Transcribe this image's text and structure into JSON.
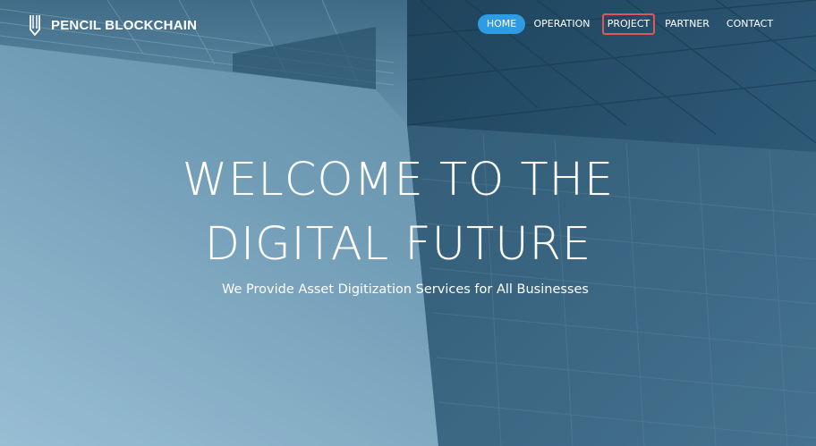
{
  "brand": {
    "name": "PENCIL BLOCKCHAIN",
    "logo_icon": "pencil-icon"
  },
  "nav": {
    "items": [
      {
        "label": "HOME",
        "state": "active"
      },
      {
        "label": "OPERATION"
      },
      {
        "label": "PROJECT",
        "state": "highlighted"
      },
      {
        "label": "PARTNER"
      },
      {
        "label": "CONTACT"
      }
    ]
  },
  "hero": {
    "headline_line1": "WELCOME TO THE",
    "headline_line2": "DIGITAL FUTURE",
    "subtitle": "We Provide Asset Digitization Services for All Businesses",
    "background": "glass-facade-building-image"
  },
  "colors": {
    "active_pill": "#2e9be2",
    "highlight_border": "#e2555a",
    "text": "#ffffff"
  }
}
